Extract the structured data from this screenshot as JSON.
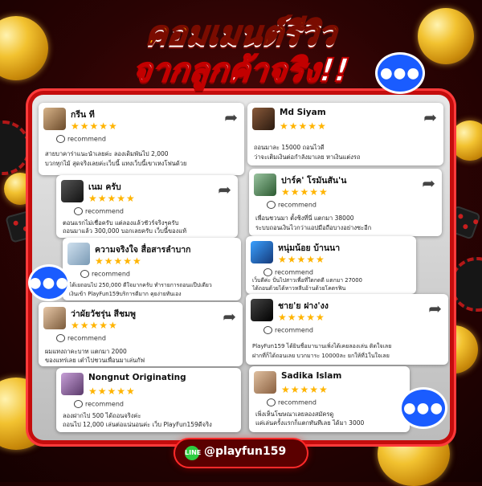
{
  "title": {
    "line1": "คอมเมนต์รีวิว",
    "line2": "จากลูกค้าจริง!!"
  },
  "recommend_label": "recommend",
  "stars": "★★★★★",
  "share_icon": "share-arrow-icon",
  "reviews": [
    {
      "name": "กรีน ที",
      "text1": "สายบาคาร่าแนะนำเลยค่ะ ลองเดิมพันไป 2,000",
      "text2": "บวกทุกไม้ สุดจริงเลยค่ะเว็บนี้ แทงเว็บนี้เขาเหงโฟนด้วย"
    },
    {
      "name": "Md Siyam",
      "text1": "ถอนมาละ 15000 ถอนไวดี",
      "text2": "ว่าจะเติมเงินต่อกำลังมาเลย หาเงินแต่งรถ"
    },
    {
      "name": "เนม ครับ",
      "text1": "ตอนแรกไม่เชื่อครับ แต่ลองแล้วชัวร์จริงๆครับ",
      "text2": "ถอนมาแล้ว 300,000 บอกเลยครับ เว็บนี้ของแท้"
    },
    {
      "name": "ปาร์ค' โรมันสัน'น",
      "text1": "เพื่อนชวนมา ตั้งชิงที่นี่ แตกมา 38000",
      "text2": "ระบบถอนเงินไวกว่าแอปมือถือบางอย่างซะอีก"
    },
    {
      "name": "ความจริงใจ สื่อสารลำบาก",
      "text1": "ได้เยถอนไป 250,000 ดีใจมากครับ ทำรายการถอนแป๊ปเดียว",
      "text2": "เงินเข้า PlayFun159บริการดีมาก คุยง่ายทันเอง"
    },
    {
      "name": "หนุ่มน้อย บ้านนา",
      "text1": "เว็บดีค่ะ ปั่นไปสาวเพื่อที่ใดกดดี แตกมา 27000",
      "text2": "ได้ถอนด้วยได้หาวหลีบอ้านด้วยโคตรฟิน"
    },
    {
      "name": "ว่าผัยวัชรุ่น สีชมพู",
      "text1": "ผมแทงถาคะบาท แตกมา 2000",
      "text2": "ของแทร่เลย เต๋าไปชวนเพื่อนมาเล่นกัฟ"
    },
    {
      "name": "ชาย'ย ฝาง'งง",
      "text1": "PlayFun159 ได้ยินชื่อมานานเพิ่งได้เคยลองเล่น ติดใจเลย",
      "text2": "ฝากที่ก็ได้ถอนเลย บวกมาระ 10000ละ ยกให้ที่1ในใจเลย"
    },
    {
      "name": "Nongnut Originating",
      "text1": "ลองฝากไป 500 ได้ถอนจริงค่ะ",
      "text2": "ถอนไป 12,000 เล่นต่อแน่นอนค่ะ เว็บ PlayFun159ดีจริง"
    },
    {
      "name": "Sadika Islam",
      "text1": "เพิ่งเห็นโฆษณาเลยลองสมัครดู",
      "text2": "แค่เล่นครั้งแรกก็แตกทันทีเลย ได้มา 3000"
    }
  ],
  "footer": {
    "line_icon_label": "LINE",
    "handle": "@playfun159"
  },
  "colors": {
    "accent": "#ffb400",
    "board_border": "#c40d0d",
    "chat_bubble": "#1a5cff",
    "line_green": "#2ecc40"
  }
}
